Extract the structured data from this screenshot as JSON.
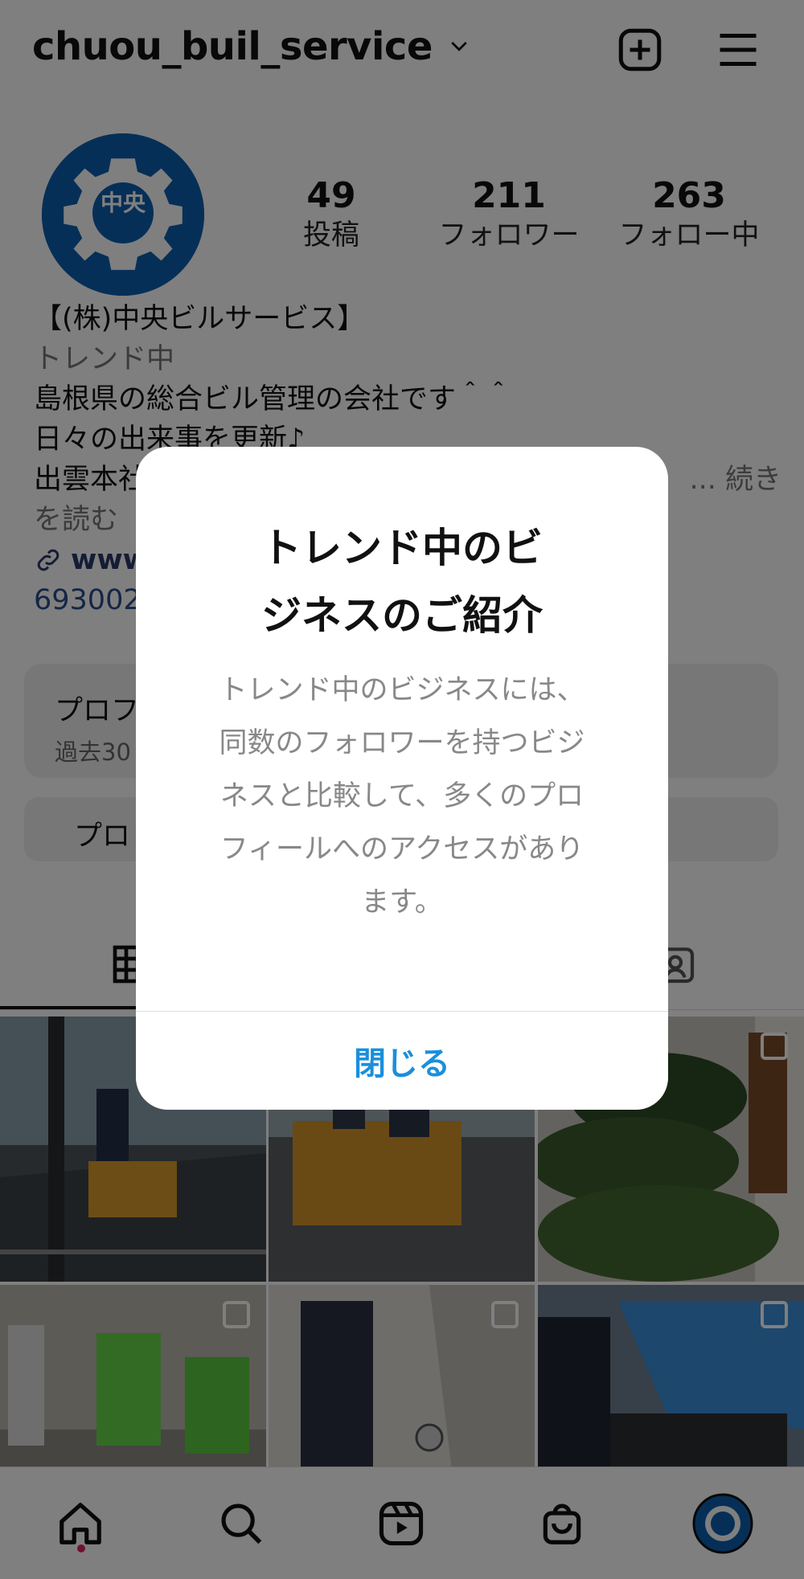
{
  "header": {
    "username": "chuou_buil_service"
  },
  "stats": [
    {
      "value": "49",
      "label": "投稿"
    },
    {
      "value": "211",
      "label": "フォロワー"
    },
    {
      "value": "263",
      "label": "フォロー中"
    }
  ],
  "bio": {
    "name": "【(株)中央ビルサービス】",
    "category": "トレンド中",
    "line1": "島根県の総合ビル管理の会社です＾＾",
    "line2": "日々の出来事を更新♪",
    "line3": "出雲本社",
    "line3_end": "... 続き",
    "read_more": "を読む",
    "link": "www",
    "address": "693002"
  },
  "dashboard": {
    "title": "プロフ",
    "subtitle": "過去30"
  },
  "edit_profile": "プロ",
  "modal": {
    "title_line1": "トレンド中のビ",
    "title_line2": "ジネスのご紹介",
    "body": [
      "トレンド中のビジネスには、",
      "同数のフォロワーを持つビジ",
      "ネスと比較して、多くのプロ",
      "フィールへのアクセスがあり",
      "ます。"
    ],
    "close_label": "閉じる"
  },
  "colors": {
    "accent_blue": "#1a8fdc",
    "brand_blue": "#0c5fb0"
  },
  "icons": {
    "header": [
      "chevron-down-icon",
      "new-post-icon",
      "menu-icon"
    ],
    "nav": [
      "home-icon",
      "search-icon",
      "reels-icon",
      "shop-icon",
      "profile-avatar"
    ]
  },
  "avatar_text": "中央"
}
